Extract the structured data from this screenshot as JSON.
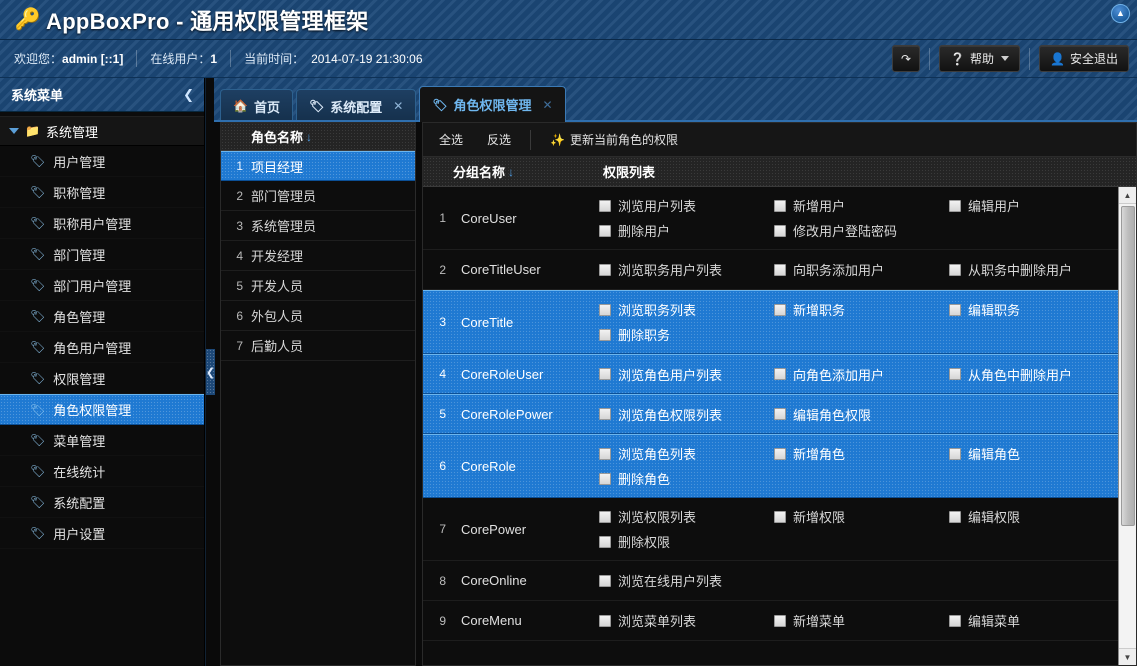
{
  "header": {
    "title": "AppBoxPro - 通用权限管理框架",
    "logo_icon": "key-icon",
    "collapse_icon": "chevron-up-icon"
  },
  "infobar": {
    "welcome_label": "欢迎您：",
    "user": "admin  [::1]",
    "online_label": "在线用户：",
    "online_count": "1",
    "time_label": "当前时间：",
    "time_value": "2014-07-19 21:30:06",
    "refresh_label": "",
    "help_label": "帮助",
    "logout_label": "安全退出"
  },
  "sidebar": {
    "title": "系统菜单",
    "collapse_icon": "chevron-left-icon",
    "group_label": "系统管理",
    "items": [
      {
        "label": "用户管理",
        "selected": false
      },
      {
        "label": "职称管理",
        "selected": false
      },
      {
        "label": "职称用户管理",
        "selected": false
      },
      {
        "label": "部门管理",
        "selected": false
      },
      {
        "label": "部门用户管理",
        "selected": false
      },
      {
        "label": "角色管理",
        "selected": false
      },
      {
        "label": "角色用户管理",
        "selected": false
      },
      {
        "label": "权限管理",
        "selected": false
      },
      {
        "label": "角色权限管理",
        "selected": true
      },
      {
        "label": "菜单管理",
        "selected": false
      },
      {
        "label": "在线统计",
        "selected": false
      },
      {
        "label": "系统配置",
        "selected": false
      },
      {
        "label": "用户设置",
        "selected": false
      }
    ]
  },
  "splitter": {
    "handle_icon": "chevron-left-icon"
  },
  "tabs": [
    {
      "label": "首页",
      "icon": "home-icon",
      "active": false,
      "closable": false
    },
    {
      "label": "系统配置",
      "icon": "tag-icon",
      "active": false,
      "closable": true
    },
    {
      "label": "角色权限管理",
      "icon": "tag-icon",
      "active": true,
      "closable": true
    }
  ],
  "role_panel": {
    "column_header": "角色名称",
    "sort_icon": "sort-desc-icon",
    "rows": [
      {
        "num": "1",
        "name": "项目经理",
        "selected": true
      },
      {
        "num": "2",
        "name": "部门管理员",
        "selected": false
      },
      {
        "num": "3",
        "name": "系统管理员",
        "selected": false
      },
      {
        "num": "4",
        "name": "开发经理",
        "selected": false
      },
      {
        "num": "5",
        "name": "开发人员",
        "selected": false
      },
      {
        "num": "6",
        "name": "外包人员",
        "selected": false
      },
      {
        "num": "7",
        "name": "后勤人员",
        "selected": false
      }
    ]
  },
  "perm_panel": {
    "toolbar": {
      "select_all": "全选",
      "invert": "反选",
      "update": "更新当前角色的权限",
      "update_icon": "refresh-star-icon"
    },
    "headers": {
      "group": "分组名称",
      "list": "权限列表",
      "sort_icon": "sort-desc-icon"
    },
    "rows": [
      {
        "num": "1",
        "group": "CoreUser",
        "selected": false,
        "perms": [
          "浏览用户列表",
          "新增用户",
          "编辑用户",
          "删除用户",
          "修改用户登陆密码"
        ]
      },
      {
        "num": "2",
        "group": "CoreTitleUser",
        "selected": false,
        "perms": [
          "浏览职务用户列表",
          "向职务添加用户",
          "从职务中删除用户"
        ]
      },
      {
        "num": "3",
        "group": "CoreTitle",
        "selected": true,
        "perms": [
          "浏览职务列表",
          "新增职务",
          "编辑职务",
          "删除职务"
        ]
      },
      {
        "num": "4",
        "group": "CoreRoleUser",
        "selected": true,
        "perms": [
          "浏览角色用户列表",
          "向角色添加用户",
          "从角色中删除用户"
        ]
      },
      {
        "num": "5",
        "group": "CoreRolePower",
        "selected": true,
        "perms": [
          "浏览角色权限列表",
          "编辑角色权限"
        ]
      },
      {
        "num": "6",
        "group": "CoreRole",
        "selected": true,
        "perms": [
          "浏览角色列表",
          "新增角色",
          "编辑角色",
          "删除角色"
        ]
      },
      {
        "num": "7",
        "group": "CorePower",
        "selected": false,
        "perms": [
          "浏览权限列表",
          "新增权限",
          "编辑权限",
          "删除权限"
        ]
      },
      {
        "num": "8",
        "group": "CoreOnline",
        "selected": false,
        "perms": [
          "浏览在线用户列表"
        ]
      },
      {
        "num": "9",
        "group": "CoreMenu",
        "selected": false,
        "perms": [
          "浏览菜单列表",
          "新增菜单",
          "编辑菜单"
        ]
      }
    ],
    "scrollbar": {
      "up_icon": "triangle-up-icon",
      "down_icon": "triangle-down-icon"
    }
  }
}
